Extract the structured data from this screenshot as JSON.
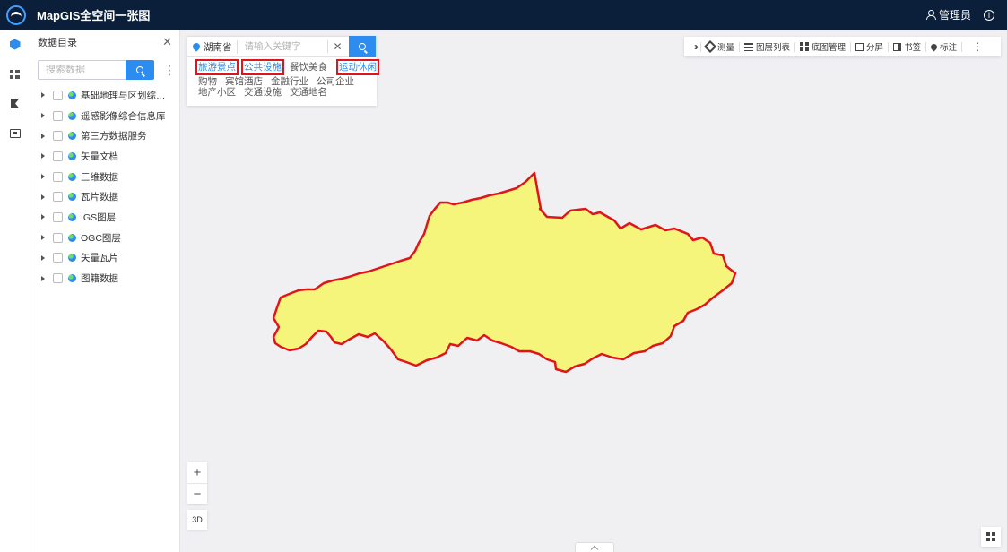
{
  "header": {
    "title": "MapGIS全空间一张图",
    "user": "管理员",
    "info_icon": "info-icon"
  },
  "rail": {
    "items": [
      "cube-icon",
      "grid-icon",
      "flag-icon",
      "screen-icon"
    ]
  },
  "catalog": {
    "title": "数据目录",
    "search_placeholder": "搜索数据",
    "items": [
      {
        "label": "基础地理与区划综合..."
      },
      {
        "label": "遥感影像综合信息库"
      },
      {
        "label": "第三方数据服务"
      },
      {
        "label": "矢量文档"
      },
      {
        "label": "三维数据"
      },
      {
        "label": "瓦片数据"
      },
      {
        "label": "IGS图层"
      },
      {
        "label": "OGC图层"
      },
      {
        "label": "矢量瓦片"
      },
      {
        "label": "图籍数据"
      }
    ]
  },
  "poi_search": {
    "region": "湖南省",
    "placeholder": "请输入关键字",
    "categories_row1": [
      "旅游景点",
      "公共设施",
      "餐饮美食",
      "运动休闲"
    ],
    "categories_row2": [
      "购物",
      "宾馆酒店",
      "金融行业",
      "公司企业"
    ],
    "categories_row3": [
      "地产小区",
      "交通设施",
      "交通地名"
    ]
  },
  "toolbar": {
    "measure": "测量",
    "layer_list": "图层列表",
    "basemap": "底图管理",
    "split": "分屏",
    "bookmark": "书签",
    "annotate": "标注"
  },
  "map_controls": {
    "zoom_in": "+",
    "zoom_out": "−",
    "three_d": "3D"
  },
  "colors": {
    "accent": "#2d8cf0",
    "header_bg": "#0b1f3a",
    "region_fill": "#f5f57c",
    "region_stroke": "#e0151c",
    "highlight_box": "#e0151c"
  }
}
